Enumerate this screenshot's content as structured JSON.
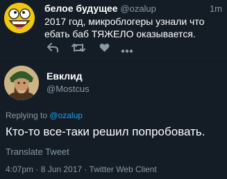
{
  "reply_tweet": {
    "display_name": "белое будущее",
    "handle": "@ozalup",
    "time": "1m",
    "text": "2017 год, микроблогеры узнали что ебать баб ТЯЖЕЛО оказывается.",
    "actions": [
      "reply-icon",
      "retweet-icon",
      "like-icon",
      "more-icon"
    ]
  },
  "main_tweet": {
    "display_name": "Евклид",
    "handle": "@Mostcus",
    "replying_label": "Replying to",
    "replying_handle": "@ozalup",
    "text": "Кто-то все-таки решил попробовать.",
    "translate": "Translate Tweet",
    "meta": "4:07pm · 8 Jun 2017 · Twitter Web Client"
  },
  "colors": {
    "background": "#141d26",
    "secondary_text": "#8899a6",
    "link": "#1da1f2"
  }
}
